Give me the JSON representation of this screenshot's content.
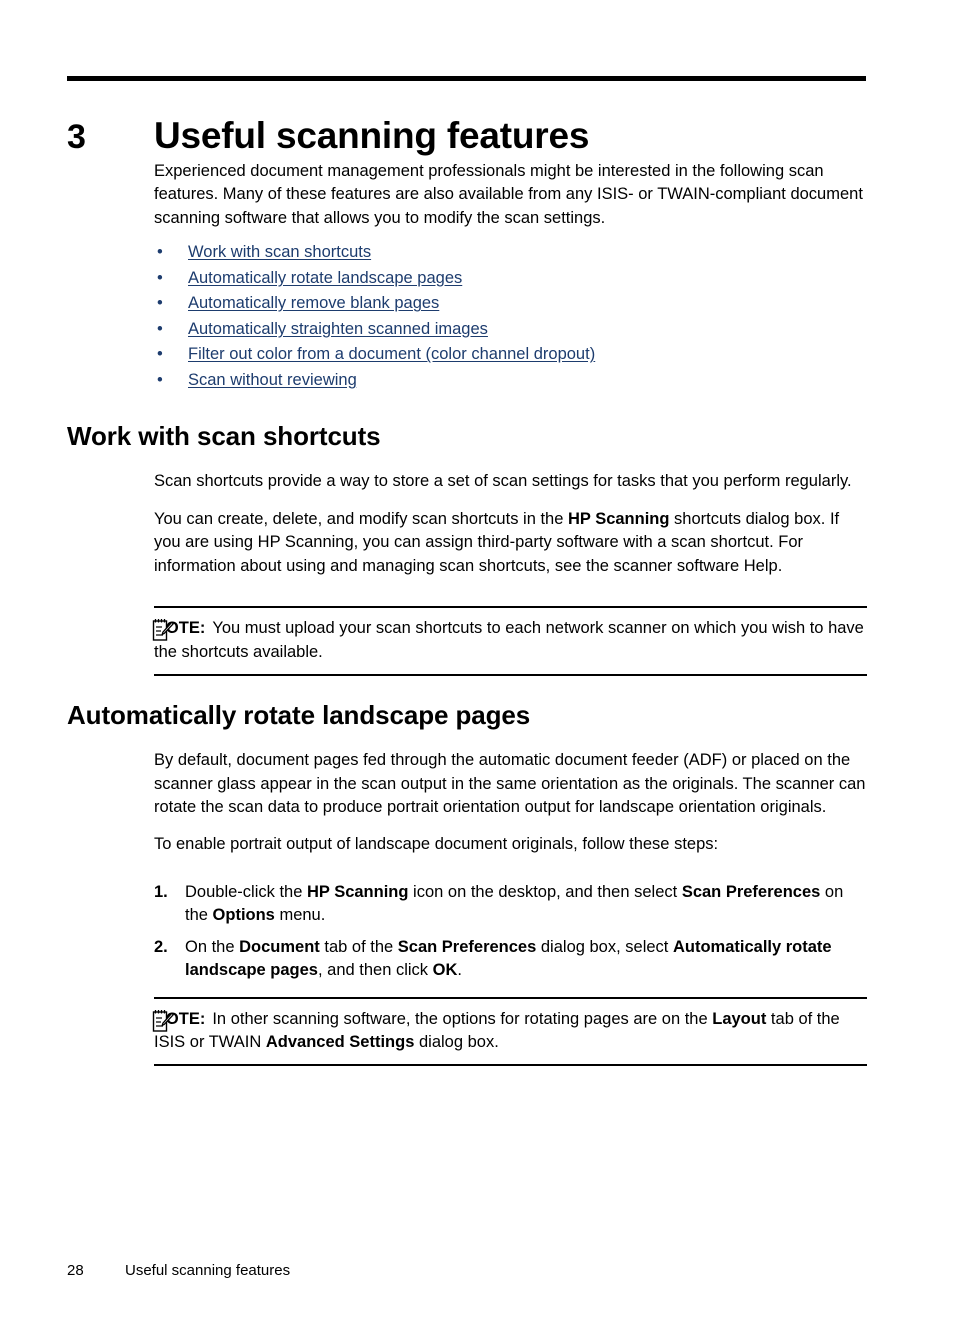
{
  "chapter": {
    "number": "3",
    "title": "Useful scanning features"
  },
  "intro": {
    "paragraph": "Experienced document management professionals might be interested in the following scan features. Many of these features are also available from any ISIS- or TWAIN-compliant document scanning software that allows you to modify the scan settings."
  },
  "toc_links": [
    {
      "bullet": "•",
      "label": "Work with scan shortcuts"
    },
    {
      "bullet": "•",
      "label": "Automatically rotate landscape pages"
    },
    {
      "bullet": "•",
      "label": "Automatically remove blank pages"
    },
    {
      "bullet": "•",
      "label": "Automatically straighten scanned images"
    },
    {
      "bullet": "•",
      "label": "Filter out color from a document (color channel dropout)"
    },
    {
      "bullet": "•",
      "label": "Scan without reviewing"
    }
  ],
  "section1": {
    "heading": "Work with scan shortcuts",
    "para1": "Scan shortcuts provide a way to store a set of scan settings for tasks that you perform regularly.",
    "para2_a": "You can create, delete, and modify scan shortcuts in the ",
    "para2_b": "HP Scanning",
    "para2_c": " shortcuts dialog box. If you are using HP Scanning, you can assign third-party software with a scan shortcut. For information about using and managing scan shortcuts, see the scanner software Help.",
    "note": {
      "icon": "note-pencil-icon",
      "label": "NOTE:",
      "text": "You must upload your scan shortcuts to each network scanner on which you wish to have the shortcuts available."
    }
  },
  "section2": {
    "heading": "Automatically rotate landscape pages",
    "para1": "By default, document pages fed through the automatic document feeder (ADF) or placed on the scanner glass appear in the scan output in the same orientation as the originals. The scanner can rotate the scan data to produce portrait orientation output for landscape orientation originals.",
    "para2": "To enable portrait output of landscape document originals, follow these steps:",
    "steps": [
      {
        "num": "1.",
        "seg1": "Double-click the ",
        "bold1": "HP Scanning",
        "seg2": " icon on the desktop, and then select ",
        "bold2": "Scan Preferences",
        "seg3": " on the ",
        "bold3": "Options",
        "seg4": " menu."
      },
      {
        "num": "2.",
        "seg1": "On the ",
        "bold1": "Document",
        "seg2": " tab of the ",
        "bold2": "Scan Preferences",
        "seg3": " dialog box, select ",
        "bold3": "Automatically rotate landscape pages",
        "seg4": ", and then click ",
        "bold4": "OK",
        "seg5": "."
      }
    ],
    "note": {
      "icon": "note-pencil-icon",
      "label": "NOTE:",
      "text_a": "In other scanning software, the options for rotating pages are on the ",
      "text_b": "Layout",
      "text_c": " tab of the ISIS or TWAIN ",
      "text_d": "Advanced Settings",
      "text_e": " dialog box."
    }
  },
  "footer": {
    "page_number": "28",
    "chapter_name": "Useful scanning features"
  },
  "colors": {
    "link": "#1d3c6e",
    "text": "#000000",
    "background": "#ffffff"
  }
}
